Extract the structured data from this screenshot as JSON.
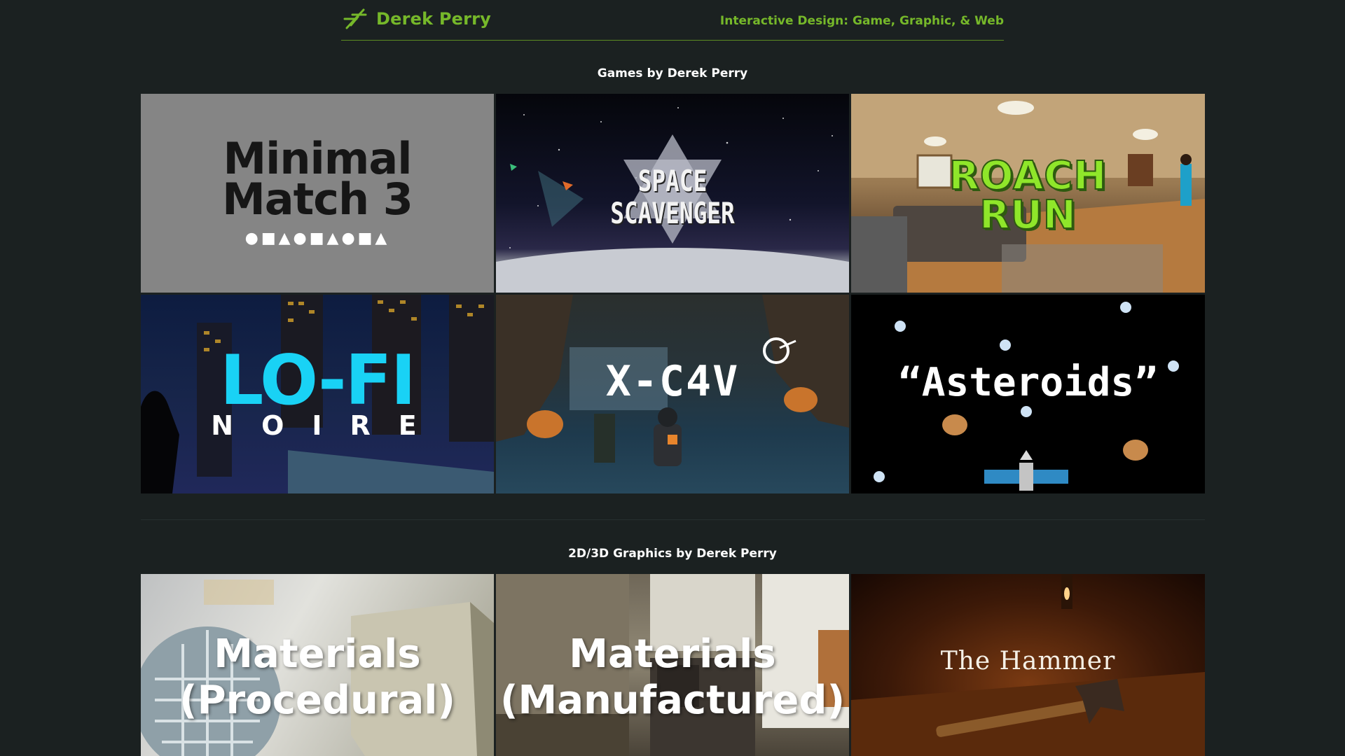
{
  "header": {
    "brand_name": "Derek Perry",
    "logo_icon": "stylized-dp-icon",
    "tagline": "Interactive Design: Game, Graphic, & Web",
    "accent_color": "#76b82a"
  },
  "sections": {
    "games": {
      "heading": "Games by Derek Perry",
      "tiles": [
        {
          "title": "Minimal Match 3",
          "line1": "Minimal",
          "line2": "Match 3",
          "shapes": "●■▲●■▲●■▲"
        },
        {
          "title": "Space Scavenger",
          "line1": "SPACE",
          "line2": "SCAVENGER"
        },
        {
          "title": "Roach Run",
          "line1": "ROACH",
          "line2": "RUN"
        },
        {
          "title": "Lo-Fi Noire",
          "line1": "LO-FI",
          "line2": "NOIRE"
        },
        {
          "title": "X-C4V",
          "line1": "X-C4V"
        },
        {
          "title": "“Asteroids”",
          "line1": "“Asteroids”"
        }
      ]
    },
    "graphics": {
      "heading": "2D/3D Graphics by Derek Perry",
      "tiles": [
        {
          "title": "Materials (Procedural)",
          "line1": "Materials",
          "line2": "(Procedural)"
        },
        {
          "title": "Materials (Manufactured)",
          "line1": "Materials",
          "line2": "(Manufactured)"
        },
        {
          "title": "The Hammer",
          "line1": "The Hammer"
        }
      ]
    }
  }
}
